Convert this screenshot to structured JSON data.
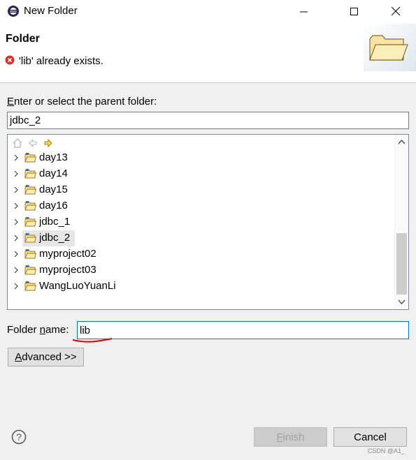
{
  "window": {
    "title": "New Folder"
  },
  "header": {
    "title": "Folder",
    "error_message": "'lib' already exists."
  },
  "parent": {
    "prompt_pre": "",
    "prompt_mnemonic": "E",
    "prompt_post": "nter or select the parent folder:",
    "value": "jdbc_2"
  },
  "tree": {
    "items": [
      {
        "label": "day13"
      },
      {
        "label": "day14"
      },
      {
        "label": "day15"
      },
      {
        "label": "day16"
      },
      {
        "label": "jdbc_1"
      },
      {
        "label": "jdbc_2"
      },
      {
        "label": "myproject02"
      },
      {
        "label": "myproject03"
      },
      {
        "label": "WangLuoYuanLi"
      }
    ],
    "selected_index": 5
  },
  "folder_name": {
    "label_pre": "Folder ",
    "label_mnemonic": "n",
    "label_post": "ame:",
    "value": "lib"
  },
  "buttons": {
    "advanced_mnemonic": "A",
    "advanced_rest": "dvanced >>",
    "finish_mnemonic": "F",
    "finish_rest": "inish",
    "cancel": "Cancel"
  },
  "watermark": "CSDN @A1_",
  "colors": {
    "error_red": "#d9312b",
    "annotation_red": "#e00000",
    "folder_yellow": "#e8c56a"
  }
}
